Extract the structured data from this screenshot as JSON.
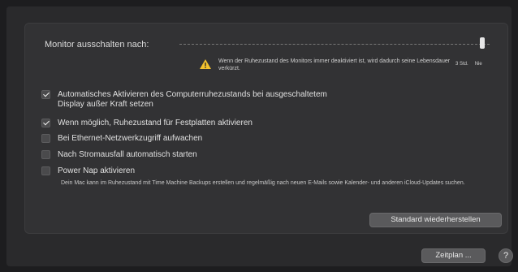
{
  "slider": {
    "label": "Monitor ausschalten nach:",
    "value_fraction": 1.0,
    "ticks": [
      "3 Std.",
      "Nie"
    ]
  },
  "warning": {
    "icon": "warning-icon",
    "text": "Wenn der Ruhezustand des Monitors immer deaktiviert ist, wird dadurch seine Lebensdauer verkürzt."
  },
  "options": [
    {
      "label_line1": "Automatisches Aktivieren des Computerruhezustands bei ausgeschaltetem",
      "label_line2": "Display außer Kraft setzen",
      "checked": true
    },
    {
      "label": "Wenn möglich, Ruhezustand für Festplatten aktivieren",
      "checked": true
    },
    {
      "label": "Bei Ethernet-Netzwerkzugriff aufwachen",
      "checked": false
    },
    {
      "label": "Nach Stromausfall automatisch starten",
      "checked": false
    },
    {
      "label": "Power Nap aktivieren",
      "checked": false
    }
  ],
  "power_nap_note": "Dein Mac kann im Ruhezustand mit Time Machine Backups erstellen und regelmäßig nach neuen E-Mails sowie Kalender- und anderen iCloud-Updates suchen.",
  "buttons": {
    "reset": "Standard wiederherstellen",
    "schedule": "Zeitplan ...",
    "help": "?"
  }
}
